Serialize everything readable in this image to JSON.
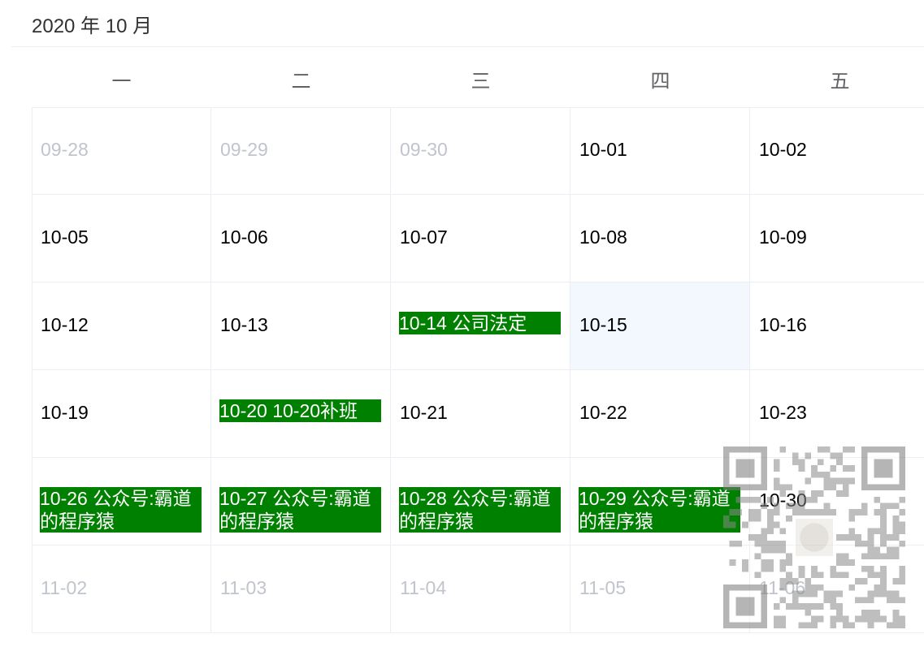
{
  "header": {
    "title": "2020 年 10 月"
  },
  "weekdays": [
    "一",
    "二",
    "三",
    "四",
    "五"
  ],
  "rows": [
    [
      {
        "text": "09-28",
        "other": true
      },
      {
        "text": "09-29",
        "other": true
      },
      {
        "text": "09-30",
        "other": true
      },
      {
        "text": "10-01"
      },
      {
        "text": "10-02"
      }
    ],
    [
      {
        "text": "10-05"
      },
      {
        "text": "10-06"
      },
      {
        "text": "10-07"
      },
      {
        "text": "10-08"
      },
      {
        "text": "10-09"
      }
    ],
    [
      {
        "text": "10-12"
      },
      {
        "text": "10-13"
      },
      {
        "text": "10-14 公司法定",
        "event": true
      },
      {
        "text": "10-15",
        "today": true
      },
      {
        "text": "10-16"
      }
    ],
    [
      {
        "text": "10-19"
      },
      {
        "text": "10-20 10-20补班",
        "event": true
      },
      {
        "text": "10-21"
      },
      {
        "text": "10-22"
      },
      {
        "text": "10-23"
      }
    ],
    [
      {
        "text": "10-26 公众号:霸道的程序猿",
        "event": true
      },
      {
        "text": "10-27 公众号:霸道的程序猿",
        "event": true
      },
      {
        "text": "10-28 公众号:霸道的程序猿",
        "event": true
      },
      {
        "text": "10-29 公众号:霸道的程序猿",
        "event": true
      },
      {
        "text": "10-30"
      }
    ],
    [
      {
        "text": "11-02",
        "other": true
      },
      {
        "text": "11-03",
        "other": true
      },
      {
        "text": "11-04",
        "other": true
      },
      {
        "text": "11-05",
        "other": true
      },
      {
        "text": "11-06",
        "other": true
      }
    ]
  ],
  "colors": {
    "event_bg": "#008000",
    "today_bg": "#f2f8fe",
    "other_month_text": "#c0c4cc",
    "border": "#ebeef5"
  },
  "watermark": {
    "icon": "qr-code-icon"
  }
}
